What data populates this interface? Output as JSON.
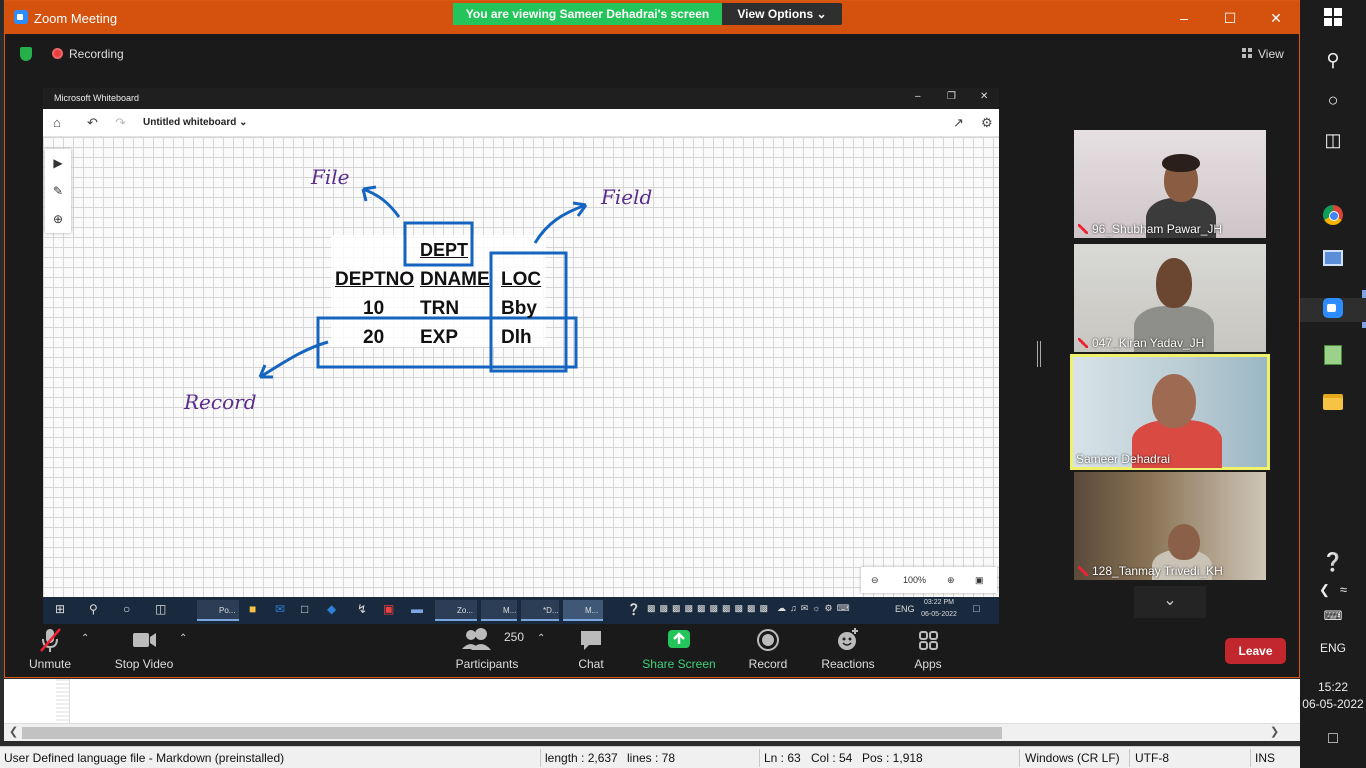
{
  "zoom": {
    "title": "Zoom Meeting",
    "banner_message": "You are viewing Sameer Dehadrai's screen",
    "view_options": "View Options",
    "recording": "Recording",
    "view": "View",
    "accent": "#d4520e",
    "banner_color": "#23c55a"
  },
  "whiteboard": {
    "app_title": "Microsoft Whiteboard",
    "doc_name": "Untitled whiteboard",
    "zoom_level": "100%",
    "annotations": {
      "file": "File",
      "field": "Field",
      "record": "Record"
    },
    "table": {
      "title": "DEPT",
      "headers": [
        "DEPTNO",
        "DNAME",
        "LOC"
      ],
      "rows": [
        [
          "10",
          "TRN",
          "Bby"
        ],
        [
          "20",
          "EXP",
          "Dlh"
        ]
      ]
    },
    "taskbar": {
      "apps": [
        "Po...",
        "Zo...",
        "M...",
        "*D...",
        "M..."
      ],
      "lang": "ENG",
      "time": "03:22 PM",
      "date": "06-05-2022"
    }
  },
  "participants_gallery": [
    {
      "name": "96_Shubham Pawar_JH",
      "muted": true,
      "active": false
    },
    {
      "name": "047_Kiran Yadav_JH",
      "muted": true,
      "active": false
    },
    {
      "name": "Sameer Dehadrai",
      "muted": false,
      "active": true
    },
    {
      "name": "128_Tanmay Trivedi_KH",
      "muted": true,
      "active": false
    }
  ],
  "controls": {
    "unmute": "Unmute",
    "stop_video": "Stop Video",
    "participants": "Participants",
    "participant_count": "250",
    "chat": "Chat",
    "share_screen": "Share Screen",
    "record": "Record",
    "reactions": "Reactions",
    "apps": "Apps",
    "leave": "Leave"
  },
  "editor_status": {
    "language": "User Defined language file - Markdown (preinstalled)",
    "length": "length : 2,637",
    "lines": "lines : 78",
    "ln": "Ln : 63",
    "col": "Col : 54",
    "pos": "Pos : 1,918",
    "eol": "Windows (CR LF)",
    "encoding": "UTF-8",
    "mode": "INS"
  },
  "system_tray": {
    "lang": "ENG",
    "time": "15:22",
    "date": "06-05-2022"
  }
}
